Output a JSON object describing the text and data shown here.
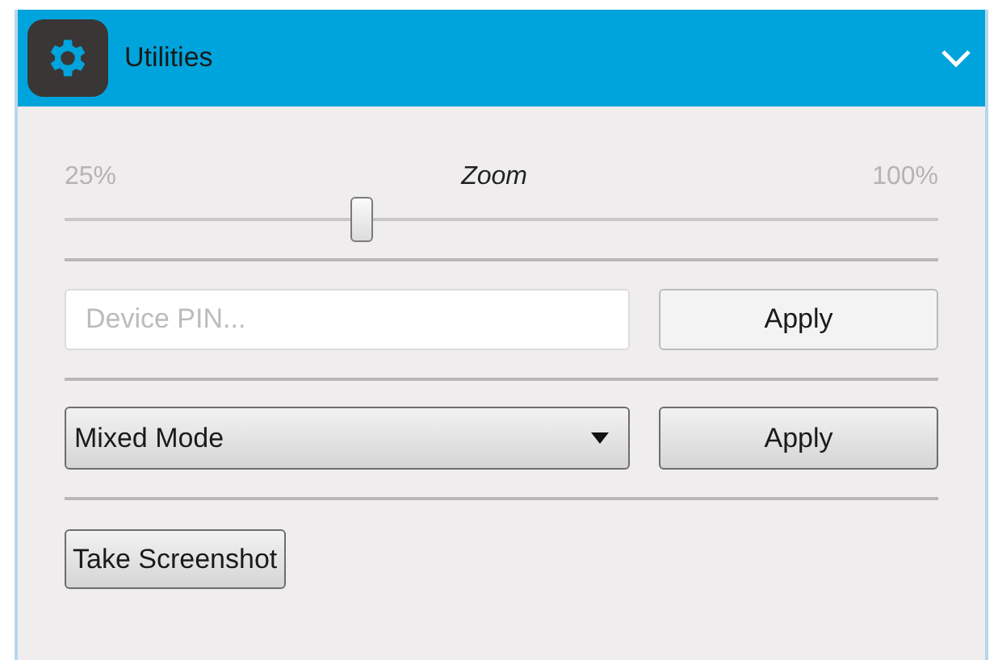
{
  "panel": {
    "title": "Utilities",
    "expanded": true
  },
  "zoom": {
    "label": "Zoom",
    "min_label": "25%",
    "max_label": "100%",
    "level": 0.34
  },
  "pin": {
    "placeholder": "Device PIN...",
    "button": "Apply"
  },
  "mode": {
    "value": "Mixed Mode",
    "button": "Apply"
  },
  "screenshot_button": "Take Screenshot"
}
